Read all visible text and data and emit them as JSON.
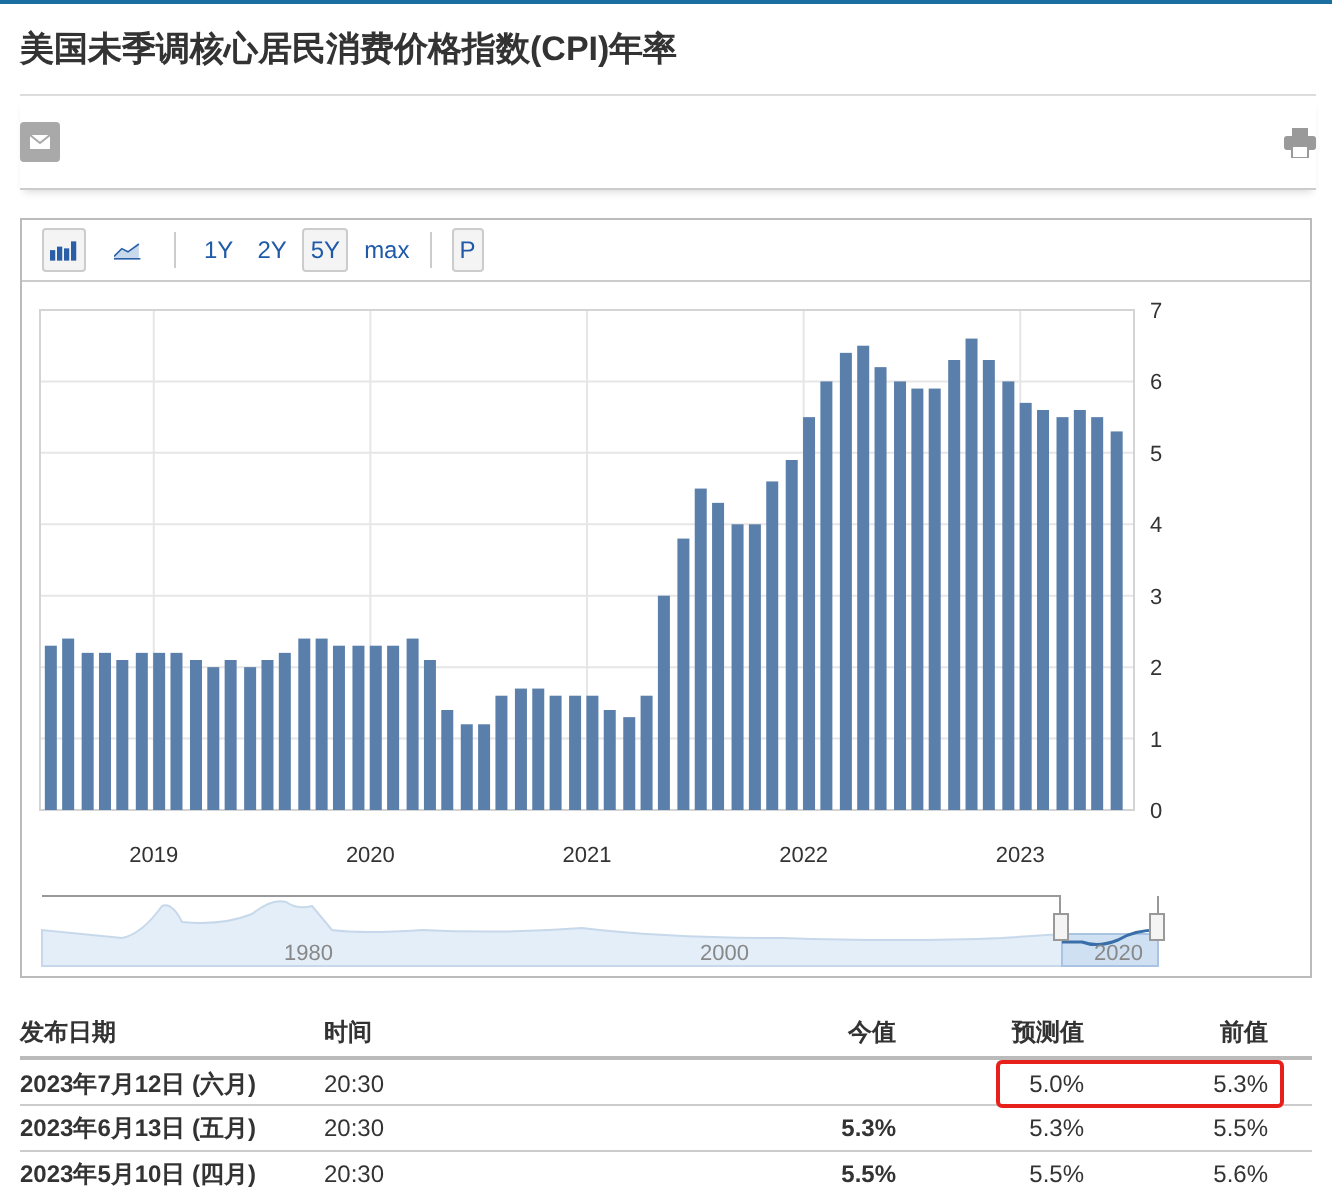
{
  "title": "美国未季调核心居民消费价格指数(CPI)年率",
  "chart_types": [
    {
      "kind": "bar",
      "selected": true
    },
    {
      "kind": "line",
      "selected": false
    }
  ],
  "ranges": [
    {
      "label": "1Y",
      "selected": false
    },
    {
      "label": "2Y",
      "selected": false
    },
    {
      "label": "5Y",
      "selected": true
    },
    {
      "label": "max",
      "selected": false
    }
  ],
  "p_button": "P",
  "chart_data": {
    "type": "bar",
    "grid": true,
    "x": [
      2018.5,
      2018.58,
      2018.67,
      2018.75,
      2018.83,
      2018.92,
      2019.0,
      2019.08,
      2019.17,
      2019.25,
      2019.33,
      2019.42,
      2019.5,
      2019.58,
      2019.67,
      2019.75,
      2019.83,
      2019.92,
      2020.0,
      2020.08,
      2020.17,
      2020.25,
      2020.33,
      2020.42,
      2020.5,
      2020.58,
      2020.67,
      2020.75,
      2020.83,
      2020.92,
      2021.0,
      2021.08,
      2021.17,
      2021.25,
      2021.33,
      2021.42,
      2021.5,
      2021.58,
      2021.67,
      2021.75,
      2021.83,
      2021.92,
      2022.0,
      2022.08,
      2022.17,
      2022.25,
      2022.33,
      2022.42,
      2022.5,
      2022.58,
      2022.67,
      2022.75,
      2022.83,
      2022.92,
      2023.0,
      2023.08,
      2023.17,
      2023.25,
      2023.33,
      2023.42
    ],
    "series": [
      {
        "color": "#5b7fab",
        "values": [
          2.3,
          2.4,
          2.2,
          2.2,
          2.1,
          2.2,
          2.2,
          2.2,
          2.1,
          2.0,
          2.1,
          2.0,
          2.1,
          2.2,
          2.4,
          2.4,
          2.3,
          2.3,
          2.3,
          2.3,
          2.4,
          2.1,
          1.4,
          1.2,
          1.2,
          1.6,
          1.7,
          1.7,
          1.6,
          1.6,
          1.6,
          1.4,
          1.3,
          1.6,
          3.0,
          3.8,
          4.5,
          4.3,
          4.0,
          4.0,
          4.6,
          4.9,
          5.5,
          6.0,
          6.4,
          6.5,
          6.2,
          6.0,
          5.9,
          5.9,
          6.3,
          6.6,
          6.3,
          6.0,
          5.7,
          5.6,
          5.5,
          5.6,
          5.5,
          5.3
        ]
      }
    ],
    "ylim": [
      0,
      7
    ],
    "yticks": [
      0,
      1,
      2,
      3,
      4,
      5,
      6,
      7
    ],
    "xlim": [
      2018.45,
      2023.5
    ],
    "xticks": [
      2019,
      2020,
      2021,
      2022,
      2023
    ]
  },
  "navigator_labels": [
    "1980",
    "2000",
    "2020"
  ],
  "table": {
    "columns": [
      "发布日期",
      "时间",
      "今值",
      "预测值",
      "前值"
    ],
    "rows": [
      {
        "date": "2023年7月12日 (六月)",
        "time": "20:30",
        "forecast": "5.0%",
        "previous": "5.3%",
        "highlighted": true
      },
      {
        "date": "2023年6月13日 (五月)",
        "time": "20:30",
        "actual": "5.3%",
        "forecast": "5.3%",
        "previous": "5.5%",
        "highlighted": false
      },
      {
        "date": "2023年5月10日 (四月)",
        "time": "20:30",
        "actual": "5.5%",
        "forecast": "5.5%",
        "previous": "5.6%",
        "highlighted": false
      }
    ]
  }
}
